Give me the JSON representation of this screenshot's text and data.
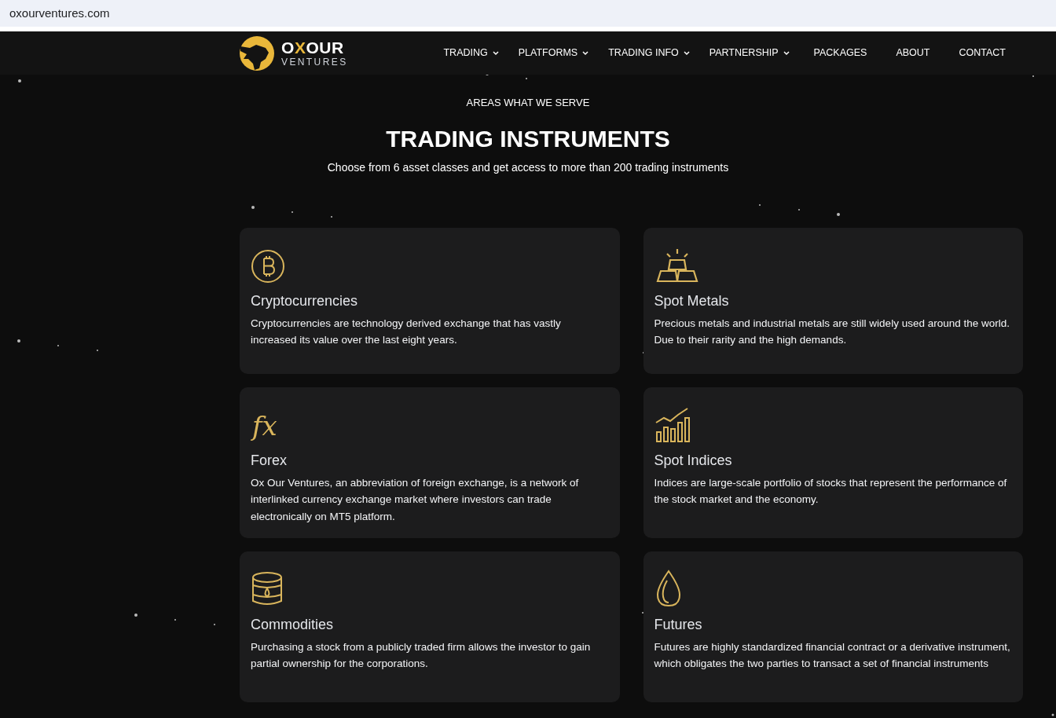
{
  "browser": {
    "url": "oxourventures.com"
  },
  "logo": {
    "wordmark": [
      {
        "text": "O",
        "accent": false
      },
      {
        "text": "X",
        "accent": true
      },
      {
        "text": "OUR",
        "accent": false
      }
    ],
    "tagline": "VENTURES"
  },
  "nav": [
    {
      "label": "TRADING",
      "dropdown": true
    },
    {
      "label": "PLATFORMS",
      "dropdown": true
    },
    {
      "label": "TRADING INFO",
      "dropdown": true
    },
    {
      "label": "PARTNERSHIP",
      "dropdown": true
    },
    {
      "label": "PACKAGES",
      "dropdown": false
    },
    {
      "label": "ABOUT",
      "dropdown": false
    },
    {
      "label": "CONTACT",
      "dropdown": false
    }
  ],
  "hero": {
    "eyebrow": "AREAS WHAT WE SERVE",
    "title": "TRADING INSTRUMENTS",
    "subtitle": "Choose from 6 asset classes and get access to more than 200 trading instruments"
  },
  "cards": [
    {
      "kind": "bitcoin",
      "title": "Cryptocurrencies",
      "text": "Cryptocurrencies are technology derived exchange that has vastly increased its value over the last eight years."
    },
    {
      "kind": "bars",
      "title": "Spot Metals",
      "text": "Precious metals and industrial metals are still widely used around the world. Due to their rarity and the high demands."
    },
    {
      "kind": "symbol",
      "symbol": "fx",
      "title": "Forex",
      "text": "Ox Our Ventures, an abbreviation of foreign exchange, is a network of interlinked currency exchange market where investors can trade electronically on MT5 platform."
    },
    {
      "kind": "chart",
      "title": "Spot Indices",
      "text": "Indices are large-scale portfolio of stocks that represent the performance of the stock market and the economy."
    },
    {
      "kind": "barrel",
      "title": "Commodities",
      "text": "Purchasing a stock from a publicly traded firm allows the investor to gain partial ownership for the corporations."
    },
    {
      "kind": "drop",
      "title": "Futures",
      "text": "Futures are highly standardized financial contract or a derivative instrument, which obligates the two parties to transact a set of financial instruments"
    }
  ]
}
